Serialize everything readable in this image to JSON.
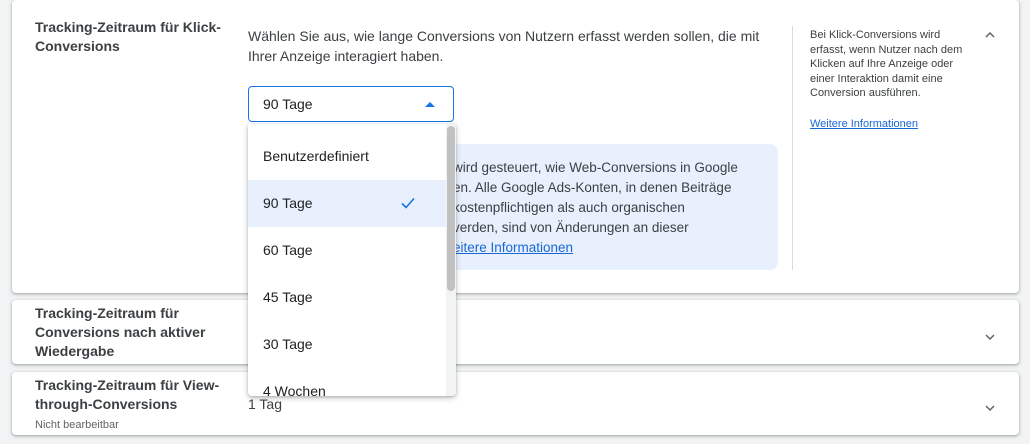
{
  "click_section": {
    "title": "Tracking-Zeitraum für Klick-Conversions",
    "description": "Wählen Sie aus, wie lange Conversions von Nutzern erfasst werden sollen, die mit Ihrer Anzeige interagiert haben.",
    "selected_value": "90 Tage",
    "info_text": "wird gesteuert, wie Web-Conversions in Google\nen. Alle Google Ads-Konten, in denen Beiträge\n kostenpflichtigen als auch organischen\nverden, sind von Änderungen an dieser",
    "info_link": "eitere Informationen",
    "help_text": "Bei Klick-Conversions wird erfasst, wenn Nutzer nach dem Klicken auf Ihre Anzeige oder einer Interaktion damit eine Conversion ausführen.",
    "help_link": "Weitere Informationen"
  },
  "engaged_section": {
    "title": "Tracking-Zeitraum für Conversions nach aktiver Wiedergabe"
  },
  "view_section": {
    "title": "Tracking-Zeitraum für View-through-Conversions",
    "subtitle": "Nicht bearbeitbar",
    "value": "1 Tag"
  },
  "dropdown": {
    "options": [
      "Benutzerdefiniert",
      "90 Tage",
      "60 Tage",
      "45 Tage",
      "30 Tage",
      "4 Wochen"
    ],
    "selected_index": 1
  },
  "colors": {
    "accent": "#1a73e8",
    "info_bg": "#e8f0fe"
  }
}
